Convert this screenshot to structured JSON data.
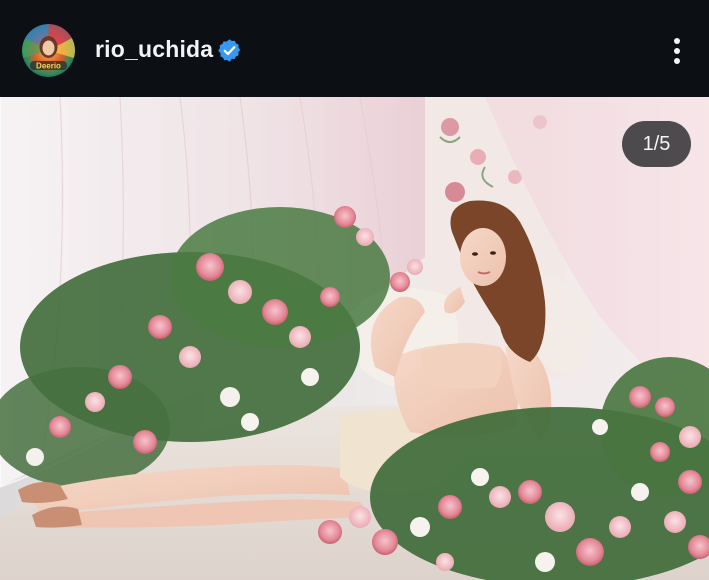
{
  "post": {
    "username": "rio_uchida",
    "avatar_caption": "Deerio",
    "verified": true,
    "verified_icon": "verified-badge-icon",
    "verified_color": "#3897f0",
    "more_icon": "more-vertical-icon"
  },
  "media": {
    "counter": "1/5",
    "image_description_icon": "photo",
    "background_color": "#0c0f14"
  }
}
